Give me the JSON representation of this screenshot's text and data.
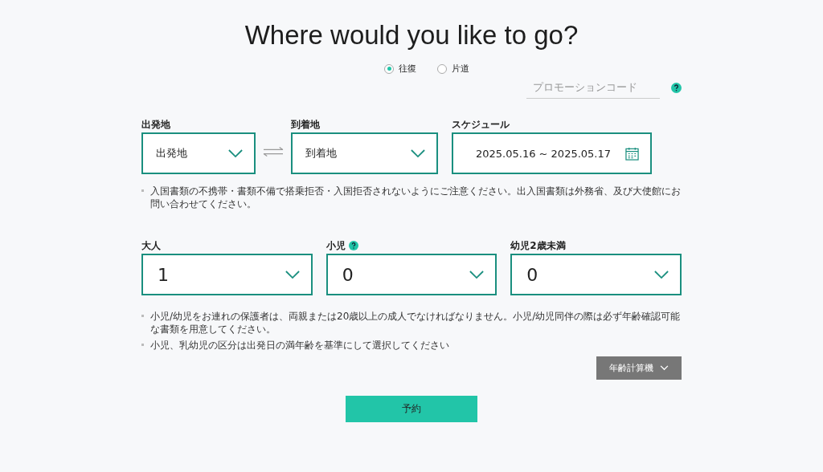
{
  "title": "Where would you like to go?",
  "trip_types": [
    {
      "label": "往復",
      "selected": true
    },
    {
      "label": "片道",
      "selected": false
    }
  ],
  "promo": {
    "placeholder": "プロモーションコード"
  },
  "route": [
    {
      "label": "出発地",
      "value": "出発地",
      "kind": "select"
    },
    {
      "label": "到着地",
      "value": "到着地",
      "kind": "select"
    },
    {
      "label": "スケジュール",
      "value": "2025.05.16 ~ 2025.05.17",
      "kind": "date"
    }
  ],
  "route_notes": [
    "入国書類の不携帯・書類不備で搭乗拒否・入国拒否されないようにご注意ください。出入国書類は外務省、及び大使館にお問い合わせてください。"
  ],
  "passengers": [
    {
      "label": "大人",
      "value": "1",
      "help": false
    },
    {
      "label": "小児",
      "value": "0",
      "help": true
    },
    {
      "label": "幼児2歳未満",
      "value": "0",
      "help": false
    }
  ],
  "passenger_notes": [
    "小児/幼児をお連れの保護者は、両親または20歳以上の成人でなければなりません。小児/幼児同伴の際は必ず年齢確認可能な書類を用意してください。",
    "小児、乳幼児の区分は出発日の満年齢を基準にして選択してください"
  ],
  "age_calculator": "年齢計算機",
  "book_button": "予約"
}
